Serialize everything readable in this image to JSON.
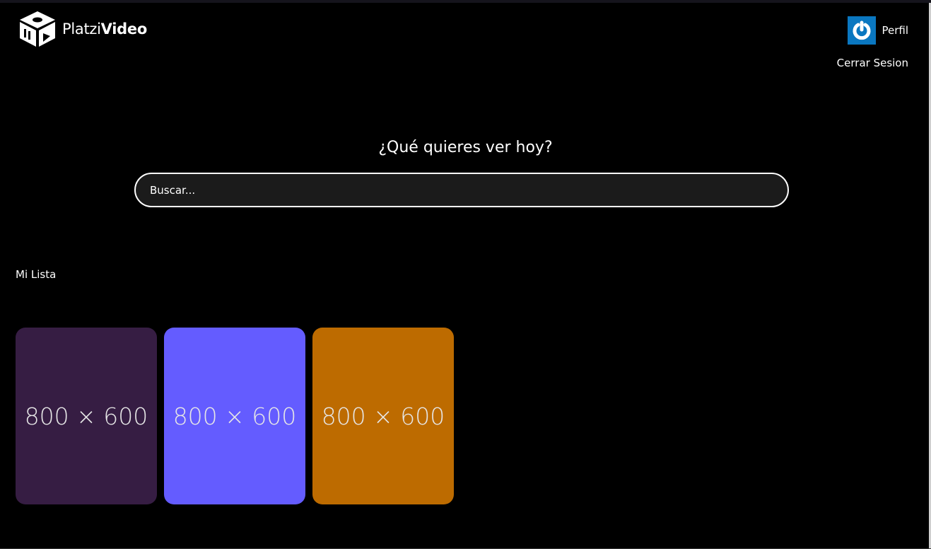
{
  "header": {
    "logo": {
      "brand_light": "Platzi",
      "brand_bold": "Video"
    },
    "profile_label": "Perfil",
    "profile_icon": "power-icon",
    "logout_label": "Cerrar Sesion"
  },
  "hero": {
    "title": "¿Qué quieres ver hoy?",
    "search_placeholder": "Buscar..."
  },
  "my_list": {
    "title": "Mi Lista",
    "items": [
      {
        "label": "800 × 600",
        "color": "#361d43"
      },
      {
        "label": "800 × 600",
        "color": "#645cff"
      },
      {
        "label": "800 × 600",
        "color": "#bd6b00"
      }
    ]
  },
  "colors": {
    "background": "#000000",
    "avatar": "#0a77c0"
  }
}
